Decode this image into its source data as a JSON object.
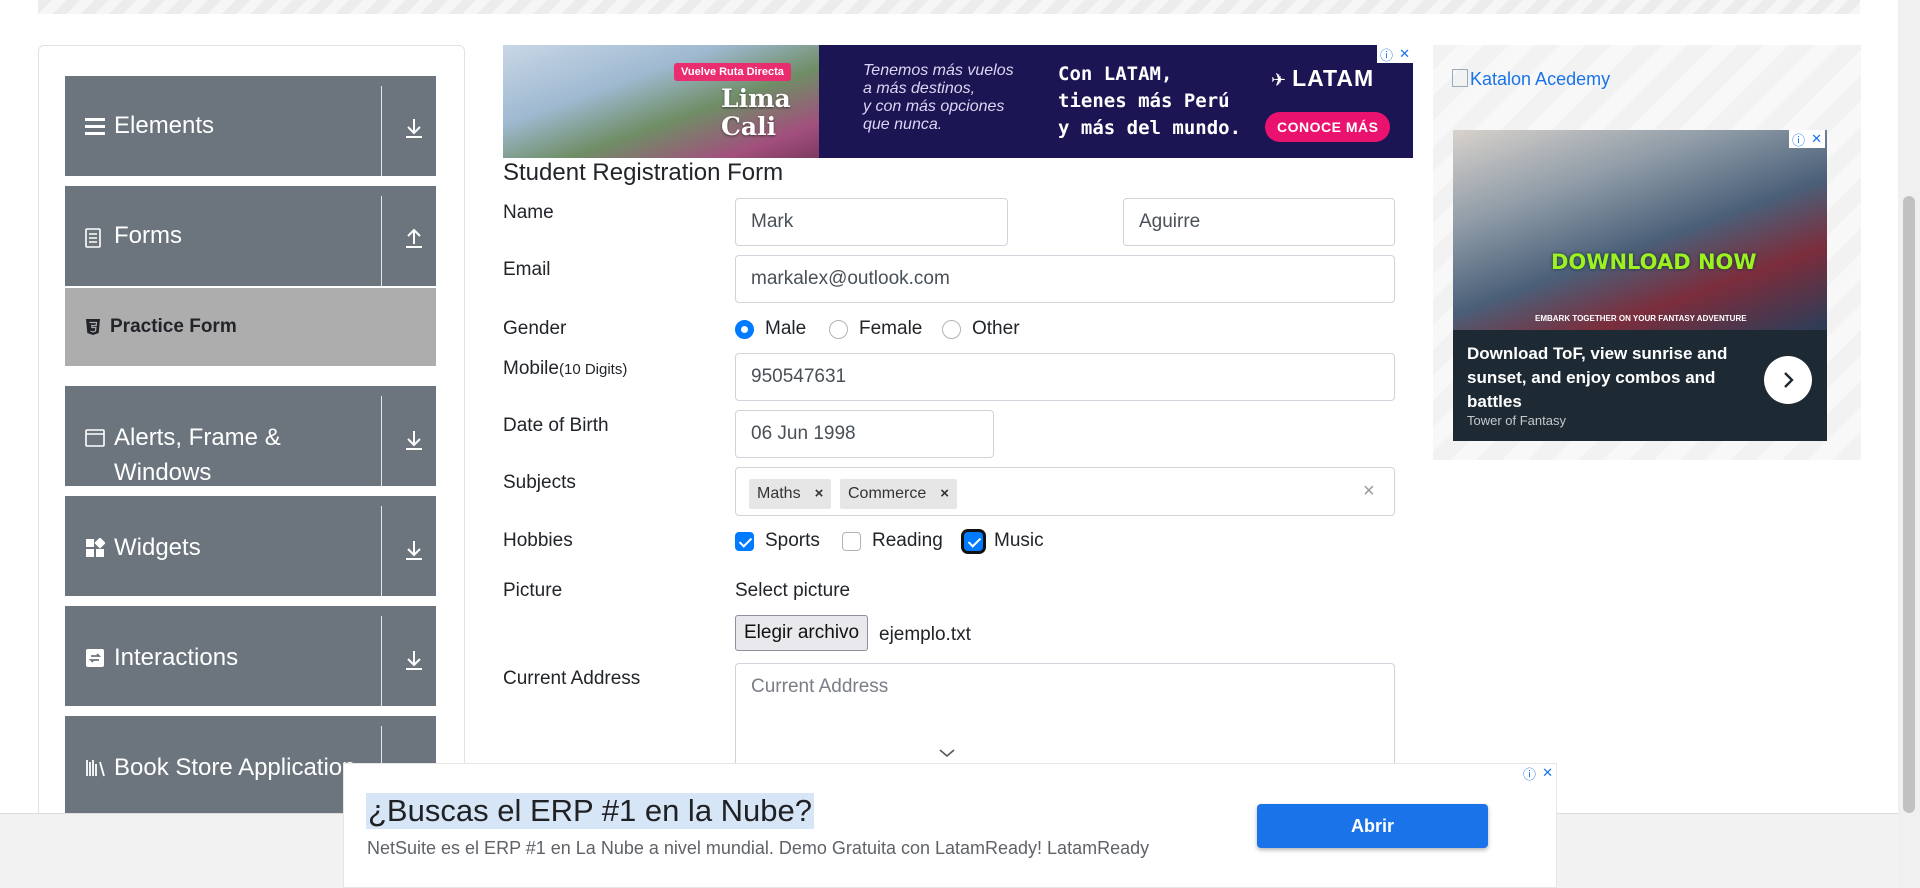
{
  "sidebar": {
    "groups": [
      {
        "label": "Elements",
        "icon": "hamburger-icon",
        "arrow": "download-icon"
      },
      {
        "label": "Forms",
        "icon": "document-icon",
        "arrow": "upload-icon"
      },
      {
        "label": "Alerts, Frame &",
        "label2": "Windows",
        "icon": "window-icon",
        "arrow": "download-icon"
      },
      {
        "label": "Widgets",
        "icon": "widgets-icon",
        "arrow": "download-icon"
      },
      {
        "label": "Interactions",
        "icon": "interactions-icon",
        "arrow": "download-icon"
      },
      {
        "label": "Book Store Application",
        "icon": "books-icon",
        "arrow": "download-icon"
      }
    ],
    "active_item": {
      "label": "Practice Form",
      "icon": "html5-icon"
    }
  },
  "ads": {
    "top": {
      "tag": "Vuelve Ruta Directa",
      "city1": "Lima",
      "city2": "Cali",
      "text1": [
        "Tenemos más vuelos",
        "a más destinos,",
        "y con más opciones",
        "que nunca."
      ],
      "text2": [
        "Con LATAM,",
        "tienes más Perú",
        "y más del mundo."
      ],
      "brand": "LATAM",
      "cta": "CONOCE MÁS"
    },
    "right": {
      "katalon": "Katalon Acedemy",
      "headline": "DOWNLOAD NOW",
      "subheadline": "EMBARK TOGETHER ON YOUR FANTASY ADVENTURE",
      "description": "Download ToF, view sunrise and sunset, and enjoy combos and battles",
      "source": "Tower of Fantasy"
    },
    "bottom": {
      "headline": "¿Buscas el ERP #1 en la Nube?",
      "body": "NetSuite es el ERP #1 en La Nube a nivel mundial. Demo Gratuita con LatamReady! LatamReady",
      "cta": "Abrir"
    }
  },
  "form": {
    "title": "Student Registration Form",
    "labels": {
      "name": "Name",
      "email": "Email",
      "gender": "Gender",
      "mobile": "Mobile",
      "mobile_hint": "(10 Digits)",
      "dob": "Date of Birth",
      "subjects": "Subjects",
      "hobbies": "Hobbies",
      "picture": "Picture",
      "address": "Current Address"
    },
    "first_name": "Mark",
    "last_name": "Aguirre",
    "email": "markalex@outlook.com",
    "gender_options": [
      {
        "label": "Male",
        "selected": true
      },
      {
        "label": "Female",
        "selected": false
      },
      {
        "label": "Other",
        "selected": false
      }
    ],
    "mobile": "950547631",
    "dob": "06 Jun 1998",
    "subjects": [
      "Maths",
      "Commerce"
    ],
    "hobbies": [
      {
        "label": "Sports",
        "checked": true
      },
      {
        "label": "Reading",
        "checked": false
      },
      {
        "label": "Music",
        "checked": true
      }
    ],
    "picture_label": "Select picture",
    "file_button": "Elegir archivo",
    "file_name": "ejemplo.txt",
    "address_placeholder": "Current Address"
  }
}
